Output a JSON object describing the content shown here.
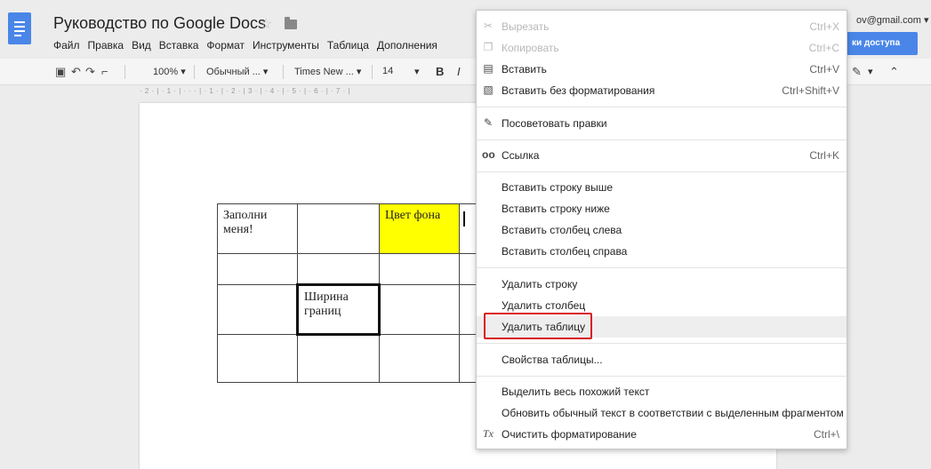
{
  "document": {
    "title": "Руководство по Google Docs",
    "star_icon": "star-icon",
    "folder_icon": "folder-icon"
  },
  "menubar": [
    "Файл",
    "Правка",
    "Вид",
    "Вставка",
    "Формат",
    "Инструменты",
    "Таблица",
    "Дополнения"
  ],
  "account": {
    "email": "ov@gmail.com ▾",
    "share_label": "ки доступа"
  },
  "toolbar": {
    "zoom": "100%",
    "style": "Обычный ...",
    "font": "Times New ...",
    "size": "14",
    "bold": "B",
    "italic": "I"
  },
  "ruler": "· 2 · | · 1 · | · · · | · 1 · | · 2 · | 3 · | · 4 · | · 5 · | · 6 · | · 7 · |",
  "table": {
    "rows": [
      [
        "Заполни меня!",
        "",
        "Цвет фона",
        ""
      ],
      [
        "",
        "",
        "",
        ""
      ],
      [
        "",
        "Ширина границ",
        "",
        ""
      ],
      [
        "",
        "",
        "",
        ""
      ]
    ]
  },
  "context_menu": {
    "items": [
      {
        "label": "Вырезать",
        "shortcut": "Ctrl+X",
        "icon": "scissors-icon",
        "disabled": true
      },
      {
        "label": "Копировать",
        "shortcut": "Ctrl+C",
        "icon": "copy-icon",
        "disabled": true
      },
      {
        "label": "Вставить",
        "shortcut": "Ctrl+V",
        "icon": "paste-icon",
        "disabled": false
      },
      {
        "label": "Вставить без форматирования",
        "shortcut": "Ctrl+Shift+V",
        "icon": "paste-plain-icon",
        "disabled": false
      },
      {
        "label": "Посоветовать правки",
        "shortcut": "",
        "icon": "suggest-icon",
        "disabled": false
      },
      {
        "label": "Ссылка",
        "shortcut": "Ctrl+K",
        "icon": "link-icon",
        "disabled": false
      },
      {
        "label": "Вставить строку выше",
        "shortcut": "",
        "icon": "",
        "disabled": false
      },
      {
        "label": "Вставить строку ниже",
        "shortcut": "",
        "icon": "",
        "disabled": false
      },
      {
        "label": "Вставить столбец слева",
        "shortcut": "",
        "icon": "",
        "disabled": false
      },
      {
        "label": "Вставить столбец справа",
        "shortcut": "",
        "icon": "",
        "disabled": false
      },
      {
        "label": "Удалить строку",
        "shortcut": "",
        "icon": "",
        "disabled": false
      },
      {
        "label": "Удалить столбец",
        "shortcut": "",
        "icon": "",
        "disabled": false
      },
      {
        "label": "Удалить таблицу",
        "shortcut": "",
        "icon": "",
        "disabled": false
      },
      {
        "label": "Свойства таблицы...",
        "shortcut": "",
        "icon": "",
        "disabled": false
      },
      {
        "label": "Выделить весь похожий текст",
        "shortcut": "",
        "icon": "",
        "disabled": false
      },
      {
        "label": "Обновить обычный текст в соответствии с выделенным фрагментом",
        "shortcut": "",
        "icon": "",
        "disabled": false
      },
      {
        "label": "Очистить форматирование",
        "shortcut": "Ctrl+\\",
        "icon": "clear-format-icon",
        "disabled": false
      }
    ]
  },
  "colors": {
    "accent": "#4a86e8",
    "highlight_box": "#d9151b",
    "cell_yellow": "#ffff00"
  }
}
